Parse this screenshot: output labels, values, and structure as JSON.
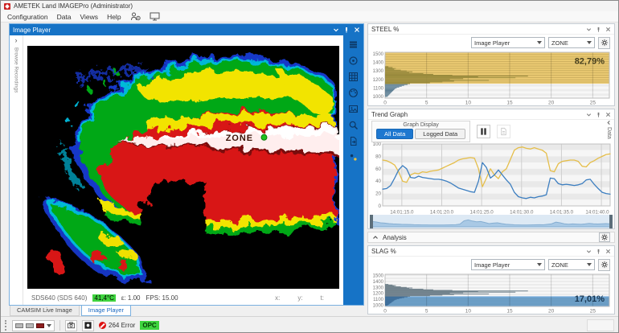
{
  "window": {
    "title": "AMETEK Land IMAGEPro (Administrator)"
  },
  "menu": {
    "items": [
      "Configuration",
      "Data",
      "Views",
      "Help"
    ]
  },
  "image_player": {
    "title": "Image Player",
    "browse_label": "Browse Recordings",
    "zone_label": "ZONE",
    "status": {
      "camera": "SDS640 (SDS 640)",
      "temperature": "41,4°C",
      "emissivity": "ε: 1.00",
      "fps": "FPS: 15.00",
      "coords": [
        "x:",
        "y:",
        "t:"
      ]
    },
    "tabs": [
      {
        "label": "CAMSIM Live Image"
      },
      {
        "label": "Image Player"
      }
    ],
    "toolbar_icons": [
      "menu-icon",
      "target-icon",
      "grid-icon",
      "palette-icon",
      "image-icon",
      "zoom-icon",
      "export-icon",
      "points-icon"
    ]
  },
  "steel_panel": {
    "title": "STEEL %",
    "source_select": "Image Player",
    "zone_select": "ZONE"
  },
  "trend_panel": {
    "title": "Trend Graph",
    "group_label": "Graph Display",
    "all_data": "All Data",
    "logged_data": "Logged Data",
    "side_tab": "Data"
  },
  "analysis": {
    "label": "Analysis"
  },
  "slag_panel": {
    "title": "SLAG %",
    "source_select": "Image Player",
    "zone_select": "ZONE"
  },
  "status_bar": {
    "error_text": "264 Error",
    "opc_label": "OPC"
  },
  "chart_data": [
    {
      "id": "steel_histogram",
      "type": "bar",
      "orientation": "horizontal",
      "title": "STEEL %",
      "value_label": "82,79%",
      "value_color": "#463f1e",
      "temp_ticks": [
        1500,
        1400,
        1300,
        1200,
        1100,
        1000
      ],
      "pct_ticks": [
        0,
        5,
        10,
        15,
        20,
        25
      ],
      "xlim": [
        0,
        27
      ],
      "ylim": [
        980,
        1520
      ],
      "threshold": 1150,
      "band": "above",
      "band_color": "#ebc768",
      "bar_color_above": "#97893c",
      "bar_color_below": "#5d7f94",
      "bars": [
        [
          1350,
          0.4
        ],
        [
          1340,
          0.9
        ],
        [
          1330,
          1.3
        ],
        [
          1320,
          1.1
        ],
        [
          1310,
          1.9
        ],
        [
          1300,
          2.6
        ],
        [
          1290,
          3.3
        ],
        [
          1280,
          2.9
        ],
        [
          1270,
          4.6
        ],
        [
          1260,
          5.8
        ],
        [
          1250,
          8.1
        ],
        [
          1240,
          17.2
        ],
        [
          1230,
          11.2
        ],
        [
          1220,
          15.7
        ],
        [
          1210,
          9.4
        ],
        [
          1200,
          7.8
        ],
        [
          1190,
          12.5
        ],
        [
          1180,
          8.3
        ],
        [
          1170,
          6.9
        ],
        [
          1160,
          5.4
        ],
        [
          1150,
          3.0
        ],
        [
          1140,
          2.7
        ],
        [
          1130,
          2.3
        ],
        [
          1120,
          2.0
        ],
        [
          1110,
          1.7
        ],
        [
          1100,
          1.4
        ],
        [
          1090,
          1.2
        ],
        [
          1080,
          1.1
        ],
        [
          1070,
          1.0
        ],
        [
          1060,
          0.9
        ],
        [
          1050,
          0.8
        ],
        [
          1040,
          0.7
        ],
        [
          1030,
          0.6
        ],
        [
          1020,
          0.5
        ],
        [
          1010,
          0.4
        ],
        [
          1000,
          0.3
        ]
      ]
    },
    {
      "id": "trend",
      "type": "line",
      "title": "Trend Graph",
      "yticks": [
        0,
        20,
        40,
        60,
        80,
        100
      ],
      "ylim": [
        0,
        100
      ],
      "x_start": 12.6,
      "x_step": 0.5,
      "x_tick_seconds": [
        15,
        20,
        25,
        30,
        35,
        40
      ],
      "x_labels": [
        "14:01:15.0",
        "14:01:20.0",
        "14:01:25.0",
        "14:01:30.0",
        "14:01:35.0",
        "14:01:40.0"
      ],
      "series": [
        {
          "name": "STEEL %",
          "color": "#e5be4a",
          "values": [
            74,
            73,
            70,
            66,
            55,
            40,
            38,
            50,
            53,
            52,
            55,
            54,
            56,
            57,
            58,
            61,
            64,
            67,
            70,
            74,
            76,
            77,
            78,
            77,
            60,
            31,
            45,
            60,
            50,
            44,
            55,
            60,
            75,
            90,
            94,
            95,
            93,
            92,
            94,
            92,
            90,
            85,
            57,
            55,
            68,
            72,
            73,
            74,
            74,
            72,
            64,
            63,
            70,
            73,
            77,
            80,
            83,
            84
          ]
        },
        {
          "name": "SLAG %",
          "color": "#3c7ec0",
          "values": [
            27,
            28,
            33,
            45,
            58,
            65,
            60,
            46,
            45,
            48,
            46,
            45,
            44,
            43,
            43,
            42,
            40,
            37,
            33,
            29,
            27,
            25,
            23,
            22,
            40,
            70,
            62,
            45,
            50,
            58,
            50,
            42,
            35,
            22,
            15,
            13,
            12,
            14,
            13,
            15,
            16,
            18,
            45,
            44,
            36,
            34,
            35,
            34,
            33,
            34,
            36,
            42,
            43,
            35,
            28,
            22,
            20,
            19
          ]
        }
      ],
      "navigator": {
        "fill": "#a9c9e5",
        "stroke": "#85aed2",
        "values": [
          0.55,
          0.5,
          0.42,
          0.38,
          0.33,
          0.3,
          0.28,
          0.26,
          0.25,
          0.24,
          0.22,
          0.21,
          0.2,
          0.2,
          0.19,
          0.18,
          0.18,
          0.19,
          0.2,
          0.21,
          0.22,
          0.28,
          0.62,
          0.72,
          0.6,
          0.52,
          0.55,
          0.45,
          0.33,
          0.38,
          0.42,
          0.33,
          0.27,
          0.24,
          0.21,
          0.2,
          0.19,
          0.18,
          0.2,
          0.21,
          0.22,
          0.21,
          0.26,
          0.32,
          0.48,
          0.42,
          0.32,
          0.27,
          0.3,
          0.28,
          0.26,
          0.3,
          0.36,
          0.32,
          0.29,
          0.31,
          0.33,
          0.31
        ]
      }
    },
    {
      "id": "slag_histogram",
      "type": "bar",
      "orientation": "horizontal",
      "title": "SLAG %",
      "value_label": "17,01%",
      "value_color": "#173652",
      "temp_ticks": [
        1500,
        1400,
        1300,
        1200,
        1100,
        1000
      ],
      "pct_ticks": [
        0,
        5,
        10,
        15,
        20,
        25
      ],
      "xlim": [
        0,
        27
      ],
      "ylim": [
        980,
        1520
      ],
      "threshold": 1150,
      "band": "below",
      "band_color": "#66a3d6",
      "bar_color_above": "#72838d",
      "bar_color_below": "#3f6f9b",
      "bars": [
        [
          1350,
          0.4
        ],
        [
          1340,
          0.9
        ],
        [
          1330,
          1.3
        ],
        [
          1320,
          1.1
        ],
        [
          1310,
          1.9
        ],
        [
          1300,
          2.6
        ],
        [
          1290,
          3.3
        ],
        [
          1280,
          2.9
        ],
        [
          1270,
          4.6
        ],
        [
          1260,
          5.8
        ],
        [
          1250,
          8.1
        ],
        [
          1240,
          17.2
        ],
        [
          1230,
          11.2
        ],
        [
          1220,
          15.7
        ],
        [
          1210,
          9.4
        ],
        [
          1200,
          7.8
        ],
        [
          1190,
          12.5
        ],
        [
          1180,
          8.3
        ],
        [
          1170,
          6.9
        ],
        [
          1160,
          5.4
        ],
        [
          1150,
          3.0
        ],
        [
          1140,
          2.7
        ],
        [
          1130,
          2.3
        ],
        [
          1120,
          2.0
        ],
        [
          1110,
          1.7
        ],
        [
          1100,
          1.4
        ],
        [
          1090,
          1.2
        ],
        [
          1080,
          1.1
        ],
        [
          1070,
          1.0
        ],
        [
          1060,
          0.9
        ],
        [
          1050,
          0.8
        ],
        [
          1040,
          0.7
        ],
        [
          1030,
          0.6
        ],
        [
          1020,
          0.5
        ],
        [
          1010,
          0.4
        ],
        [
          1000,
          0.3
        ]
      ]
    }
  ]
}
